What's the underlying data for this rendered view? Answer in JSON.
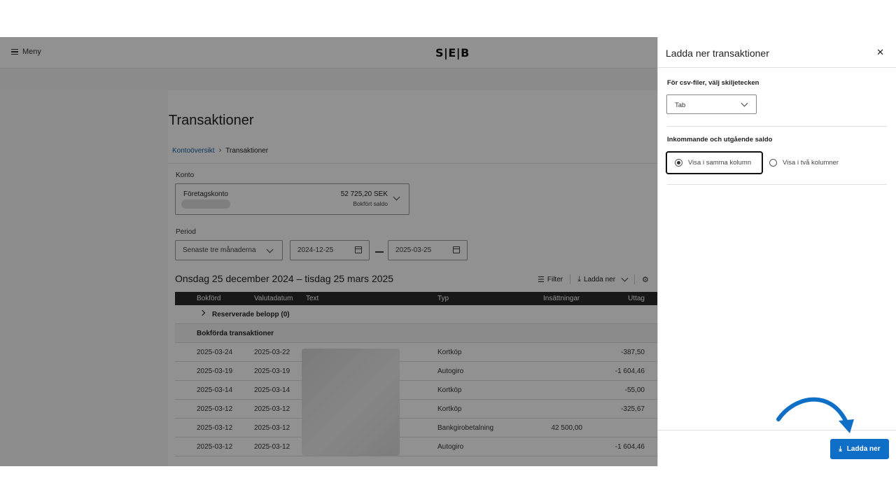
{
  "header": {
    "menu_label": "Meny",
    "logo": "S|E|B"
  },
  "page": {
    "title": "Transaktioner",
    "breadcrumb": {
      "link": "Kontoöversikt",
      "current": "Transaktioner"
    }
  },
  "account": {
    "label": "Konto",
    "name": "Företagskonto",
    "amount": "52 725,20 SEK",
    "amount_caption": "Bokfört saldo"
  },
  "period": {
    "label": "Period",
    "preset": "Senaste tre månaderna",
    "from": "2024-12-25",
    "to": "2025-03-25"
  },
  "range_title": "Onsdag 25 december 2024 – tisdag 25 mars 2025",
  "toolbar": {
    "filter": "Filter",
    "download": "Ladda ner"
  },
  "table": {
    "columns": [
      "Bokförd",
      "Valutadatum",
      "Text",
      "Typ",
      "Insättningar",
      "Uttag"
    ],
    "reserved": "Reserverade belopp (0)",
    "booked_header": "Bokförda transaktioner",
    "rows": [
      {
        "booked": "2025-03-24",
        "value_date": "2025-03-22",
        "type": "Kortköp",
        "deposit": "",
        "withdrawal": "-387,50"
      },
      {
        "booked": "2025-03-19",
        "value_date": "2025-03-19",
        "type": "Autogiro",
        "deposit": "",
        "withdrawal": "-1 604,46"
      },
      {
        "booked": "2025-03-14",
        "value_date": "2025-03-14",
        "type": "Kortköp",
        "deposit": "",
        "withdrawal": "-55,00"
      },
      {
        "booked": "2025-03-12",
        "value_date": "2025-03-12",
        "type": "Kortköp",
        "deposit": "",
        "withdrawal": "-325,67"
      },
      {
        "booked": "2025-03-12",
        "value_date": "2025-03-12",
        "type": "Bankgirobetalning",
        "deposit": "42 500,00",
        "withdrawal": ""
      },
      {
        "booked": "2025-03-12",
        "value_date": "2025-03-12",
        "type": "Autogiro",
        "deposit": "",
        "withdrawal": "-1 604,46"
      }
    ]
  },
  "drawer": {
    "title": "Ladda ner transaktioner",
    "separator_label": "För csv-filer, välj skiljetecken",
    "separator_value": "Tab",
    "balance_label": "Inkommande och utgående saldo",
    "option_same": "Visa i samma kolumn",
    "option_two": "Visa i två kolumner",
    "selected_option": "same",
    "download_button": "Ladda ner"
  },
  "colors": {
    "primary_button": "#0f6fc6",
    "annotation_arrow": "#0f6fc6"
  }
}
